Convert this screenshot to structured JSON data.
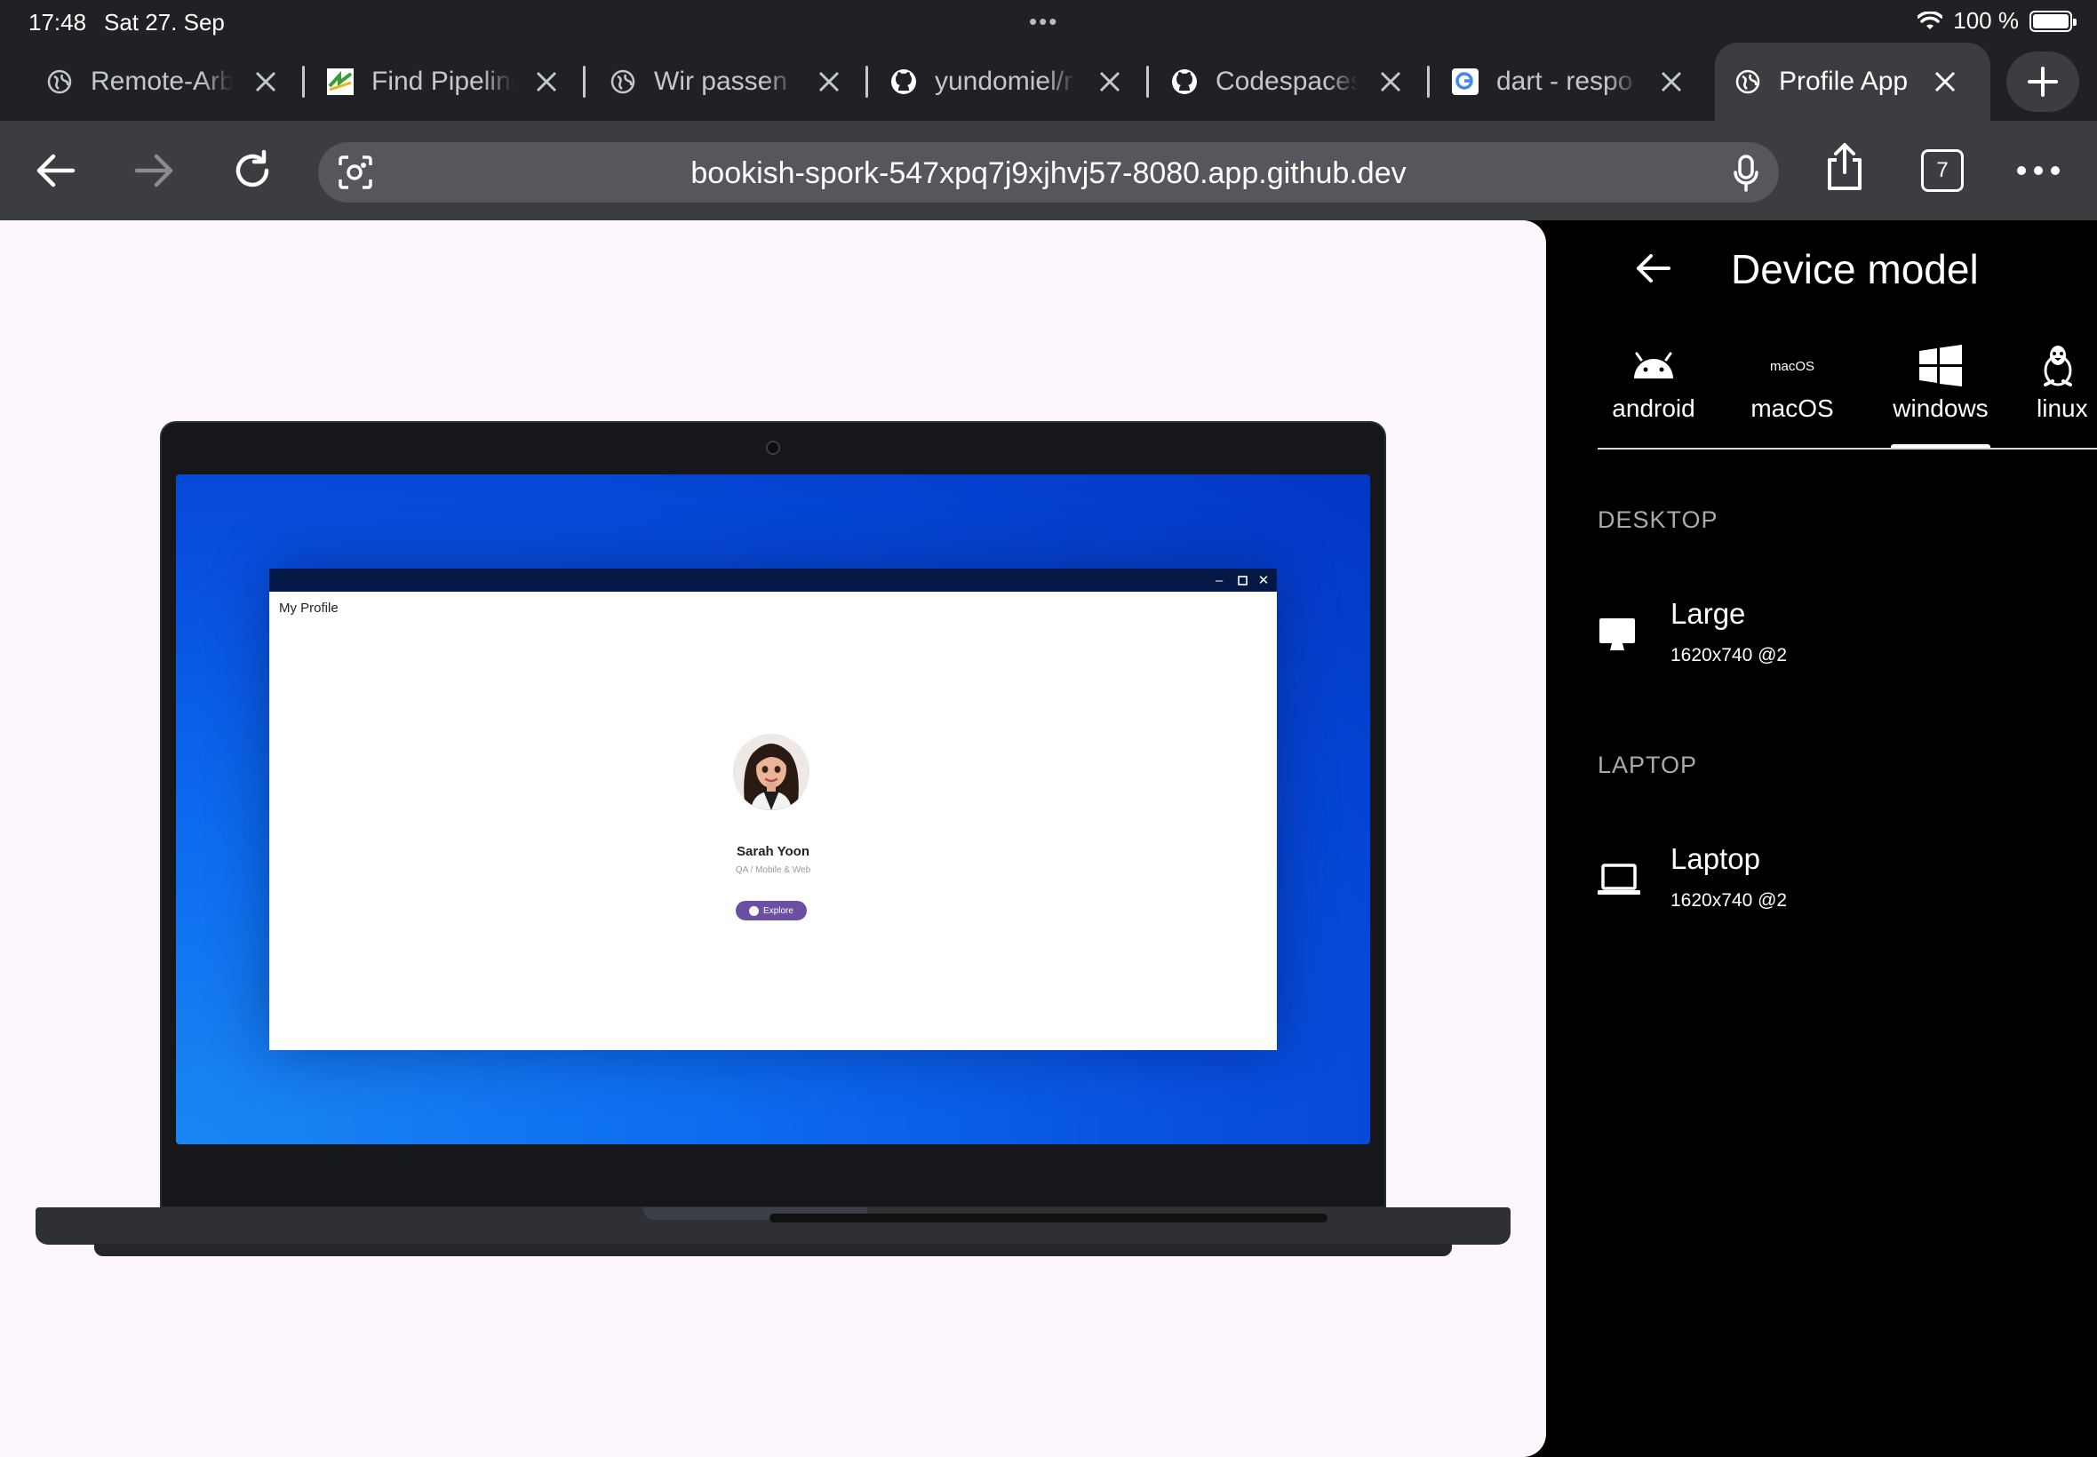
{
  "status_bar": {
    "time": "17:48",
    "date": "Sat 27. Sep",
    "battery": "100 %"
  },
  "tabs": [
    {
      "label": "Remote-Arbeit",
      "icon": "globe-icon"
    },
    {
      "label": "Find Pipelines",
      "icon": "pipeline-icon"
    },
    {
      "label": "Wir passen uns",
      "icon": "globe-icon"
    },
    {
      "label": "yundomiel/r",
      "icon": "github-icon"
    },
    {
      "label": "Codespaces",
      "icon": "github-icon"
    },
    {
      "label": "dart - respo",
      "icon": "google-icon"
    },
    {
      "label": "Profile App",
      "icon": "globe-icon",
      "active": true
    }
  ],
  "toolbar": {
    "url": "bookish-spork-547xpq7j9xjhvj57-8080.app.github.dev",
    "tab_count": "7"
  },
  "preview": {
    "app_title": "My Profile",
    "profile_name": "Sarah Yoon",
    "profile_role": "QA / Mobile & Web",
    "button_label": "Explore"
  },
  "panel": {
    "title": "Device model",
    "os_tabs": [
      {
        "label": "android",
        "icon": "android-icon"
      },
      {
        "label": "macOS",
        "icon_text": "macOS"
      },
      {
        "label": "windows",
        "icon": "windows-icon",
        "selected": true
      },
      {
        "label": "linux",
        "icon": "linux-icon"
      }
    ],
    "sections": [
      {
        "heading": "DESKTOP",
        "devices": [
          {
            "name": "Large",
            "spec": "1620x740 @2",
            "icon": "monitor-icon"
          }
        ]
      },
      {
        "heading": "LAPTOP",
        "devices": [
          {
            "name": "Laptop",
            "spec": "1620x740 @2",
            "icon": "laptop-icon"
          }
        ]
      }
    ]
  },
  "colors": {
    "browser_bg": "#202124",
    "toolbar_bg": "#3c3d41",
    "preview_bg": "#fdf7fd",
    "screen_blue": "#0850e0",
    "explore_button": "#6a4fa3"
  }
}
